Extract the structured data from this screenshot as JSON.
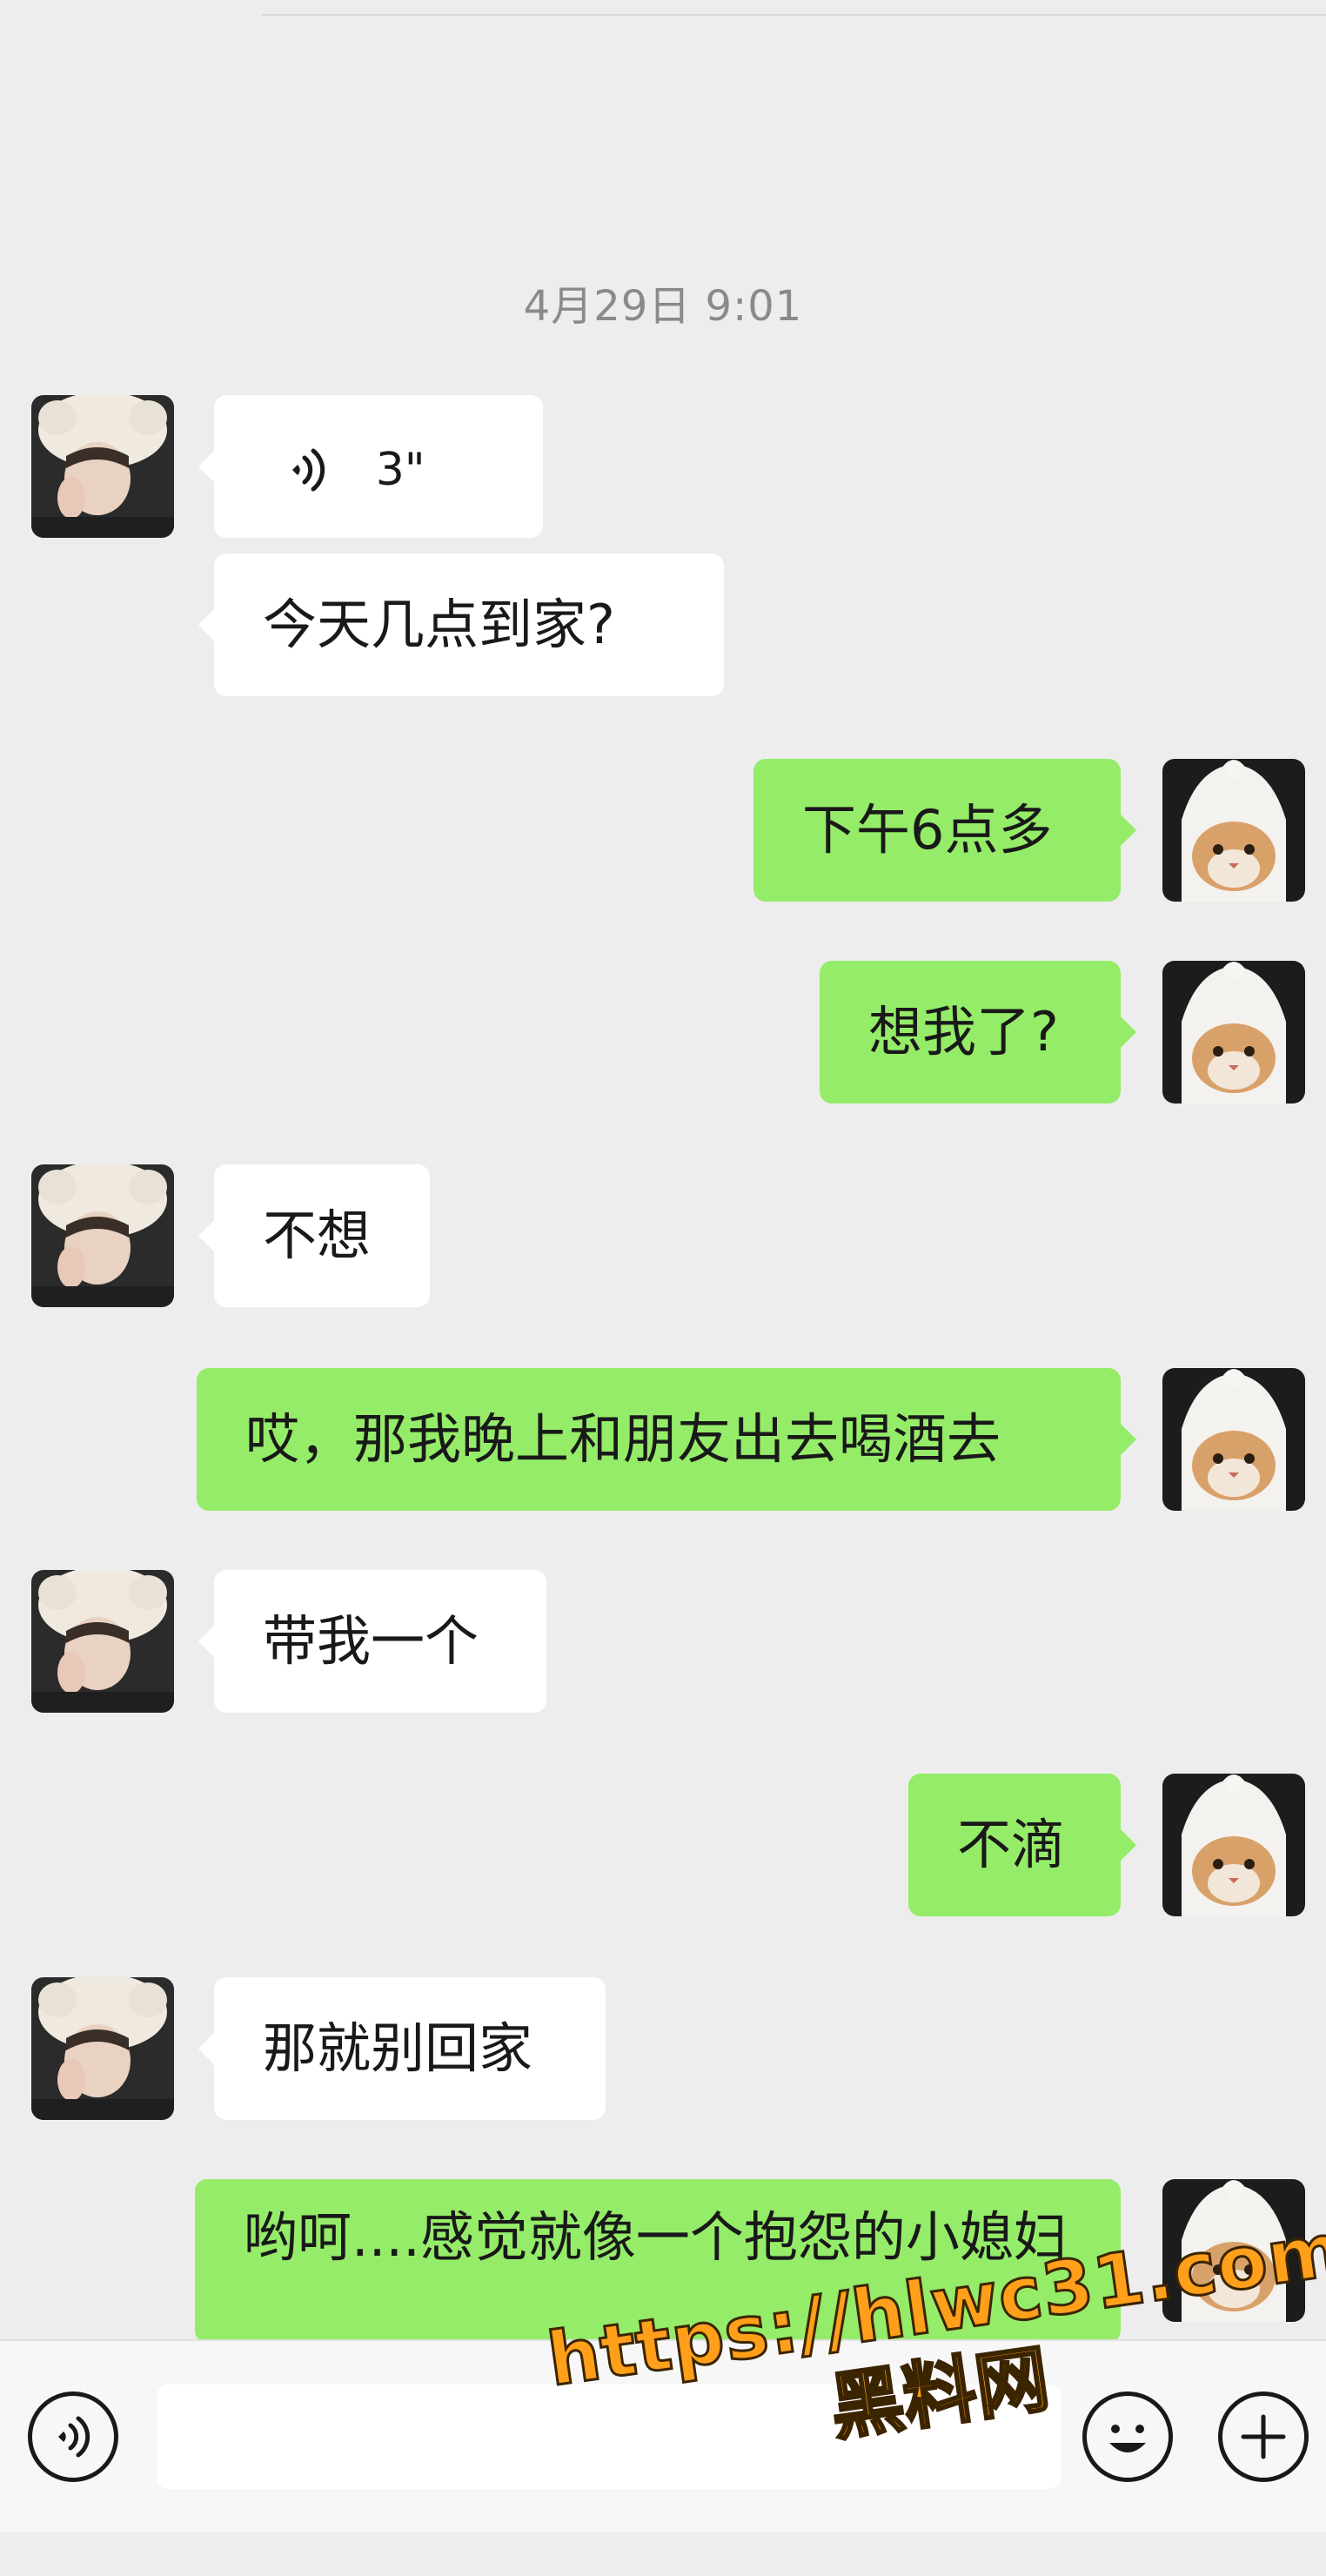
{
  "chat": {
    "timestamp": "4月29日 9:01",
    "voice_message": {
      "duration": "3\""
    },
    "messages": [
      {
        "side": "left",
        "text": "今天几点到家?"
      },
      {
        "side": "right",
        "text": "下午6点多"
      },
      {
        "side": "right",
        "text": "想我了?"
      },
      {
        "side": "left",
        "text": "不想"
      },
      {
        "side": "right",
        "text": "哎，那我晚上和朋友出去喝酒去"
      },
      {
        "side": "left",
        "text": "带我一个"
      },
      {
        "side": "right",
        "text": "不滴"
      },
      {
        "side": "left",
        "text": "那就别回家"
      },
      {
        "side": "right",
        "text": "哟呵....感觉就像一个抱怨的小媳妇"
      }
    ]
  },
  "input_bar": {
    "voice_icon": "voice-mode-icon",
    "emoji_icon": "emoji-icon",
    "plus_icon": "plus-icon"
  },
  "watermark": {
    "url": "https://hlwc31.com",
    "name": "黑料网"
  },
  "colors": {
    "background": "#ededed",
    "incoming_bubble": "#ffffff",
    "outgoing_bubble": "#95ec69",
    "watermark": "#ff9f1a"
  }
}
